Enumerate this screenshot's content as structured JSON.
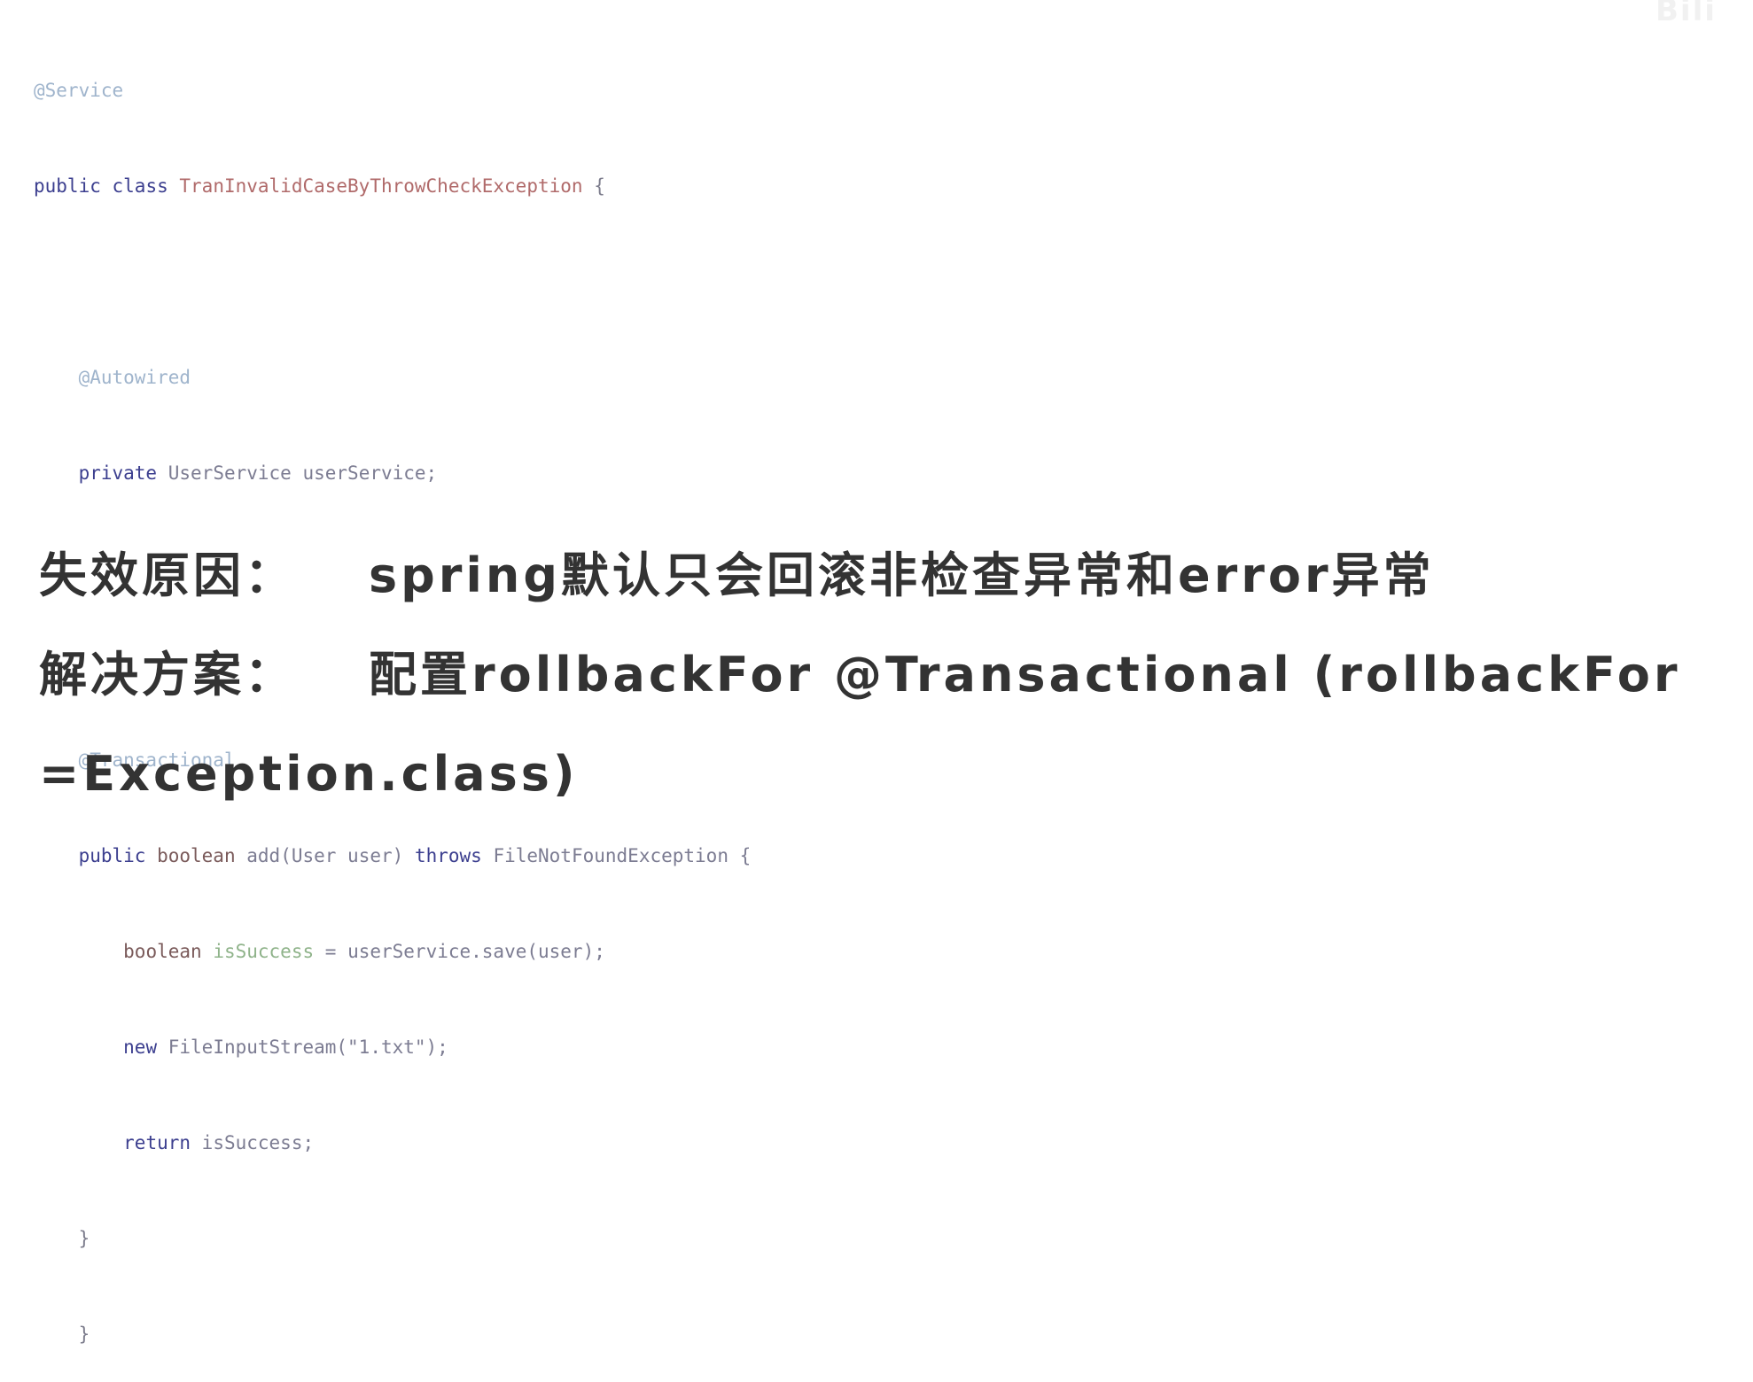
{
  "watermark": "Bili",
  "code": {
    "l1_annotation": "@Service",
    "l2_public": "public",
    "l2_class": "class",
    "l2_name": "TranInvalidCaseByThrowCheckException",
    "l2_brace": "{",
    "l4_annotation": "@Autowired",
    "l5_private": "private",
    "l5_type": "UserService",
    "l5_field": "userService;",
    "l8_annotation": "@Transactional",
    "l9_public": "public",
    "l9_boolean": "boolean",
    "l9_sig": "add(User user)",
    "l9_throws": "throws",
    "l9_exc": "FileNotFoundException {",
    "l10_boolean": "boolean",
    "l10_var": "isSuccess",
    "l10_rest": "= userService.save(user);",
    "l11_new": "new",
    "l11_rest": "FileInputStream(\"1.txt\");",
    "l12_return": "return",
    "l12_rest": "isSuccess;",
    "l13_brace": "}",
    "l14_brace": "}"
  },
  "notes": {
    "reason_label": "失效原因：",
    "reason_text": "spring默认只会回滚非检查异常和error异常",
    "solution_label": "解决方案：",
    "solution_text": "配置rollbackFor @Transactional (rollbackFor",
    "solution_cont": "=Exception.class)"
  }
}
